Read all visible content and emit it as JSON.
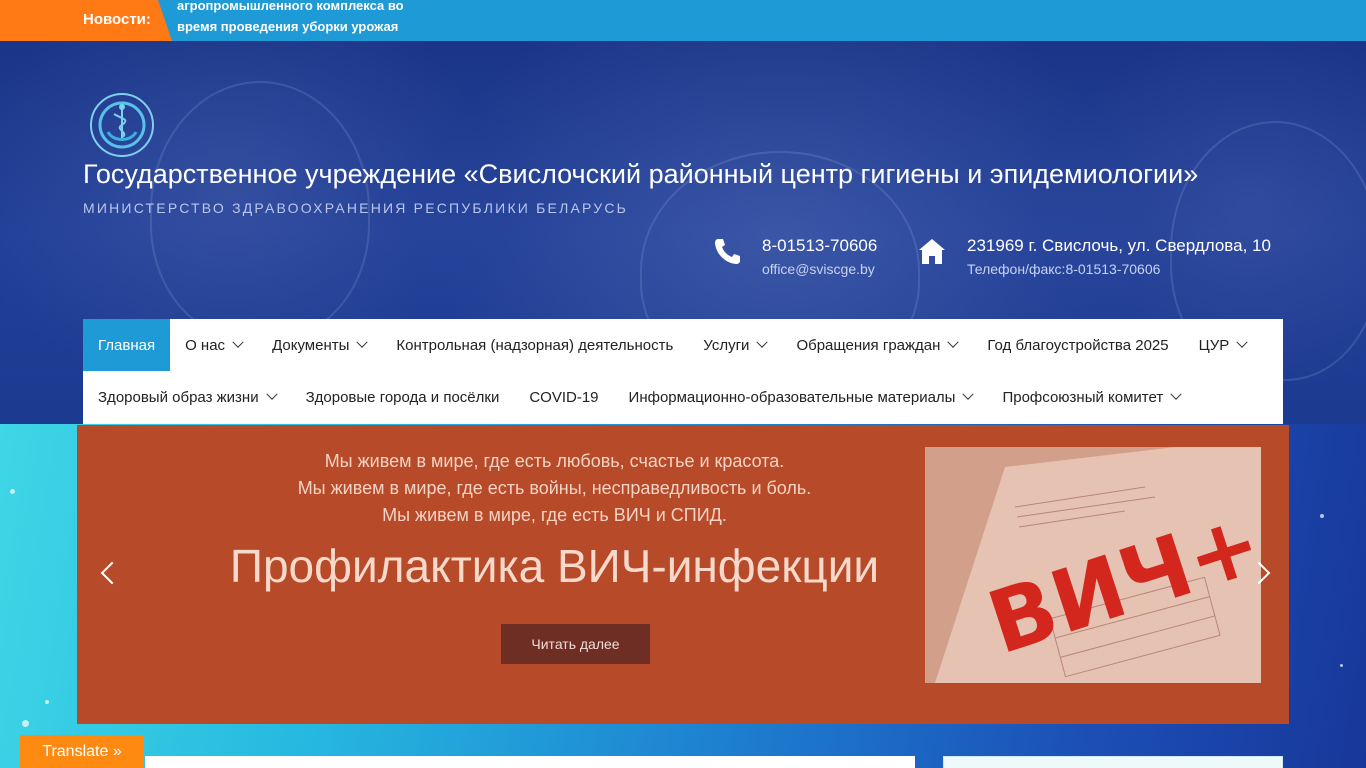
{
  "ticker": {
    "label": "Новости:",
    "text": "агропромышленного комплекса во время проведения уборки урожая"
  },
  "header": {
    "title": "Государственное учреждение «Свислочский районный центр гигиены и эпидемиологии»",
    "subtitle": "МИНИСТЕРСТВО ЗДРАВООХРАНЕНИЯ РЕСПУБЛИКИ БЕЛАРУСЬ",
    "phone": {
      "icon": "phone-icon",
      "main": "8-01513-70606",
      "sub": "office@sviscge.by"
    },
    "address": {
      "icon": "home-icon",
      "main": "231969 г. Свислочь, ул. Свердлова, 10",
      "sub": "Телефон/факс:8-01513-70606"
    }
  },
  "nav": {
    "row1": [
      {
        "label": "Главная",
        "active": true,
        "dropdown": false
      },
      {
        "label": "О нас",
        "dropdown": true
      },
      {
        "label": "Документы",
        "dropdown": true
      },
      {
        "label": "Контрольная (надзорная) деятельность",
        "dropdown": false
      },
      {
        "label": "Услуги",
        "dropdown": true
      },
      {
        "label": "Обращения граждан",
        "dropdown": true
      },
      {
        "label": "Год благоустройства 2025",
        "dropdown": false
      },
      {
        "label": "ЦУР",
        "dropdown": true
      }
    ],
    "row2": [
      {
        "label": "Здоровый образ жизни",
        "dropdown": true
      },
      {
        "label": "Здоровые города и посёлки",
        "dropdown": false
      },
      {
        "label": "COVID-19",
        "dropdown": false
      },
      {
        "label": "Информационно-образовательные материалы",
        "dropdown": true
      },
      {
        "label": "Профсоюзный комитет",
        "dropdown": true
      }
    ]
  },
  "slider": {
    "lines": [
      "Мы живем в мире, где есть любовь, счастье и красота.",
      "Мы живем в мире, где есть войны, несправедливость и боль.",
      "Мы живем в мире, где есть ВИЧ и СПИД."
    ],
    "title": "Профилактика ВИЧ-инфекции",
    "button": "Читать далее",
    "image_text": "ВИЧ+"
  },
  "translate": "Translate »",
  "colors": {
    "ticker_bg": "#1e9ad6",
    "ticker_label_bg": "#ff7a15",
    "nav_active": "#1e9ad6",
    "slide_bg": "#b74a28",
    "slide_button": "#6e2e24",
    "translate_bg": "#ff8a12"
  }
}
